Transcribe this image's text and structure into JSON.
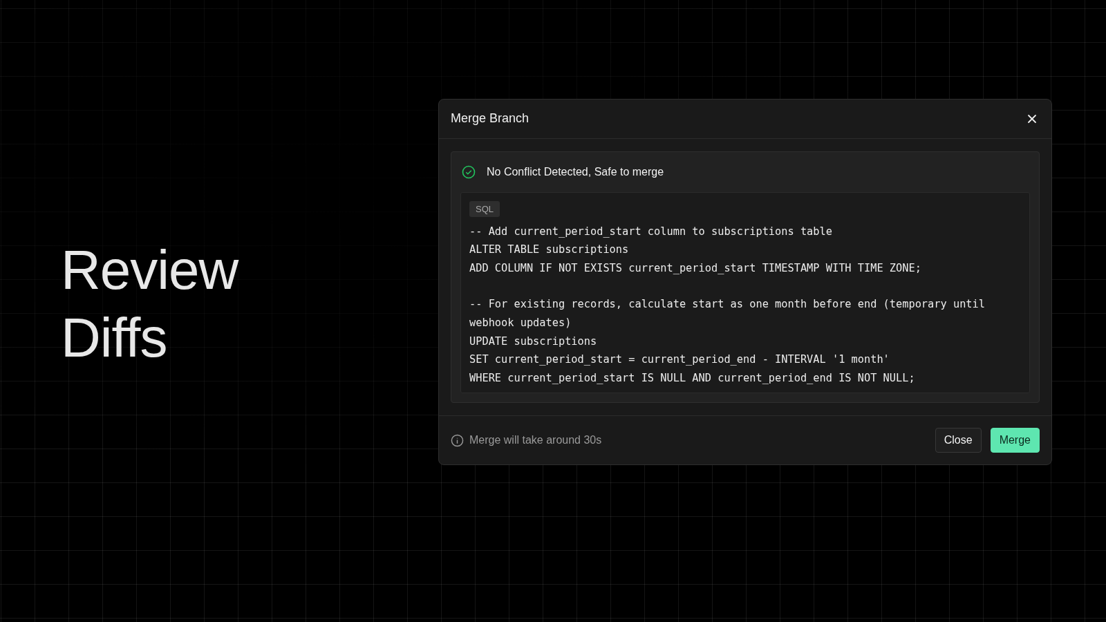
{
  "hero": {
    "title": "Review Diffs"
  },
  "dialog": {
    "title": "Merge Branch",
    "status": {
      "kind": "success",
      "text": "No Conflict Detected, Safe to merge"
    },
    "code": {
      "language": "SQL",
      "blocks": [
        [
          "-- Add current_period_start column to subscriptions table",
          "ALTER TABLE subscriptions",
          "ADD COLUMN IF NOT EXISTS current_period_start TIMESTAMP WITH TIME ZONE;"
        ],
        [
          "-- For existing records, calculate start as one month before end (temporary until webhook updates)",
          "UPDATE subscriptions",
          "SET current_period_start = current_period_end - INTERVAL '1 month'",
          "WHERE current_period_start IS NULL AND current_period_end IS NOT NULL;"
        ]
      ]
    },
    "footer_note": "Merge will take around 30s",
    "buttons": [
      {
        "label": "Close",
        "kind": "secondary"
      },
      {
        "label": "Merge",
        "kind": "primary"
      }
    ]
  }
}
